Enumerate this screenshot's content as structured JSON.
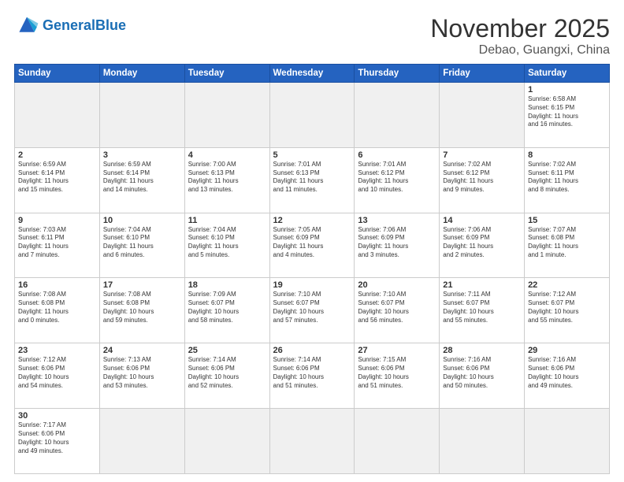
{
  "header": {
    "logo_general": "General",
    "logo_blue": "Blue",
    "month_title": "November 2025",
    "location": "Debao, Guangxi, China"
  },
  "days_of_week": [
    "Sunday",
    "Monday",
    "Tuesday",
    "Wednesday",
    "Thursday",
    "Friday",
    "Saturday"
  ],
  "weeks": [
    [
      {
        "day": "",
        "info": "",
        "empty": true
      },
      {
        "day": "",
        "info": "",
        "empty": true
      },
      {
        "day": "",
        "info": "",
        "empty": true
      },
      {
        "day": "",
        "info": "",
        "empty": true
      },
      {
        "day": "",
        "info": "",
        "empty": true
      },
      {
        "day": "",
        "info": "",
        "empty": true
      },
      {
        "day": "1",
        "info": "Sunrise: 6:58 AM\nSunset: 6:15 PM\nDaylight: 11 hours\nand 16 minutes.",
        "empty": false
      }
    ],
    [
      {
        "day": "2",
        "info": "Sunrise: 6:59 AM\nSunset: 6:14 PM\nDaylight: 11 hours\nand 15 minutes.",
        "empty": false
      },
      {
        "day": "3",
        "info": "Sunrise: 6:59 AM\nSunset: 6:14 PM\nDaylight: 11 hours\nand 14 minutes.",
        "empty": false
      },
      {
        "day": "4",
        "info": "Sunrise: 7:00 AM\nSunset: 6:13 PM\nDaylight: 11 hours\nand 13 minutes.",
        "empty": false
      },
      {
        "day": "5",
        "info": "Sunrise: 7:01 AM\nSunset: 6:13 PM\nDaylight: 11 hours\nand 11 minutes.",
        "empty": false
      },
      {
        "day": "6",
        "info": "Sunrise: 7:01 AM\nSunset: 6:12 PM\nDaylight: 11 hours\nand 10 minutes.",
        "empty": false
      },
      {
        "day": "7",
        "info": "Sunrise: 7:02 AM\nSunset: 6:12 PM\nDaylight: 11 hours\nand 9 minutes.",
        "empty": false
      },
      {
        "day": "8",
        "info": "Sunrise: 7:02 AM\nSunset: 6:11 PM\nDaylight: 11 hours\nand 8 minutes.",
        "empty": false
      }
    ],
    [
      {
        "day": "9",
        "info": "Sunrise: 7:03 AM\nSunset: 6:11 PM\nDaylight: 11 hours\nand 7 minutes.",
        "empty": false
      },
      {
        "day": "10",
        "info": "Sunrise: 7:04 AM\nSunset: 6:10 PM\nDaylight: 11 hours\nand 6 minutes.",
        "empty": false
      },
      {
        "day": "11",
        "info": "Sunrise: 7:04 AM\nSunset: 6:10 PM\nDaylight: 11 hours\nand 5 minutes.",
        "empty": false
      },
      {
        "day": "12",
        "info": "Sunrise: 7:05 AM\nSunset: 6:09 PM\nDaylight: 11 hours\nand 4 minutes.",
        "empty": false
      },
      {
        "day": "13",
        "info": "Sunrise: 7:06 AM\nSunset: 6:09 PM\nDaylight: 11 hours\nand 3 minutes.",
        "empty": false
      },
      {
        "day": "14",
        "info": "Sunrise: 7:06 AM\nSunset: 6:09 PM\nDaylight: 11 hours\nand 2 minutes.",
        "empty": false
      },
      {
        "day": "15",
        "info": "Sunrise: 7:07 AM\nSunset: 6:08 PM\nDaylight: 11 hours\nand 1 minute.",
        "empty": false
      }
    ],
    [
      {
        "day": "16",
        "info": "Sunrise: 7:08 AM\nSunset: 6:08 PM\nDaylight: 11 hours\nand 0 minutes.",
        "empty": false
      },
      {
        "day": "17",
        "info": "Sunrise: 7:08 AM\nSunset: 6:08 PM\nDaylight: 10 hours\nand 59 minutes.",
        "empty": false
      },
      {
        "day": "18",
        "info": "Sunrise: 7:09 AM\nSunset: 6:07 PM\nDaylight: 10 hours\nand 58 minutes.",
        "empty": false
      },
      {
        "day": "19",
        "info": "Sunrise: 7:10 AM\nSunset: 6:07 PM\nDaylight: 10 hours\nand 57 minutes.",
        "empty": false
      },
      {
        "day": "20",
        "info": "Sunrise: 7:10 AM\nSunset: 6:07 PM\nDaylight: 10 hours\nand 56 minutes.",
        "empty": false
      },
      {
        "day": "21",
        "info": "Sunrise: 7:11 AM\nSunset: 6:07 PM\nDaylight: 10 hours\nand 55 minutes.",
        "empty": false
      },
      {
        "day": "22",
        "info": "Sunrise: 7:12 AM\nSunset: 6:07 PM\nDaylight: 10 hours\nand 55 minutes.",
        "empty": false
      }
    ],
    [
      {
        "day": "23",
        "info": "Sunrise: 7:12 AM\nSunset: 6:06 PM\nDaylight: 10 hours\nand 54 minutes.",
        "empty": false
      },
      {
        "day": "24",
        "info": "Sunrise: 7:13 AM\nSunset: 6:06 PM\nDaylight: 10 hours\nand 53 minutes.",
        "empty": false
      },
      {
        "day": "25",
        "info": "Sunrise: 7:14 AM\nSunset: 6:06 PM\nDaylight: 10 hours\nand 52 minutes.",
        "empty": false
      },
      {
        "day": "26",
        "info": "Sunrise: 7:14 AM\nSunset: 6:06 PM\nDaylight: 10 hours\nand 51 minutes.",
        "empty": false
      },
      {
        "day": "27",
        "info": "Sunrise: 7:15 AM\nSunset: 6:06 PM\nDaylight: 10 hours\nand 51 minutes.",
        "empty": false
      },
      {
        "day": "28",
        "info": "Sunrise: 7:16 AM\nSunset: 6:06 PM\nDaylight: 10 hours\nand 50 minutes.",
        "empty": false
      },
      {
        "day": "29",
        "info": "Sunrise: 7:16 AM\nSunset: 6:06 PM\nDaylight: 10 hours\nand 49 minutes.",
        "empty": false
      }
    ],
    [
      {
        "day": "30",
        "info": "Sunrise: 7:17 AM\nSunset: 6:06 PM\nDaylight: 10 hours\nand 49 minutes.",
        "empty": false
      },
      {
        "day": "",
        "info": "",
        "empty": true
      },
      {
        "day": "",
        "info": "",
        "empty": true
      },
      {
        "day": "",
        "info": "",
        "empty": true
      },
      {
        "day": "",
        "info": "",
        "empty": true
      },
      {
        "day": "",
        "info": "",
        "empty": true
      },
      {
        "day": "",
        "info": "",
        "empty": true
      }
    ]
  ]
}
